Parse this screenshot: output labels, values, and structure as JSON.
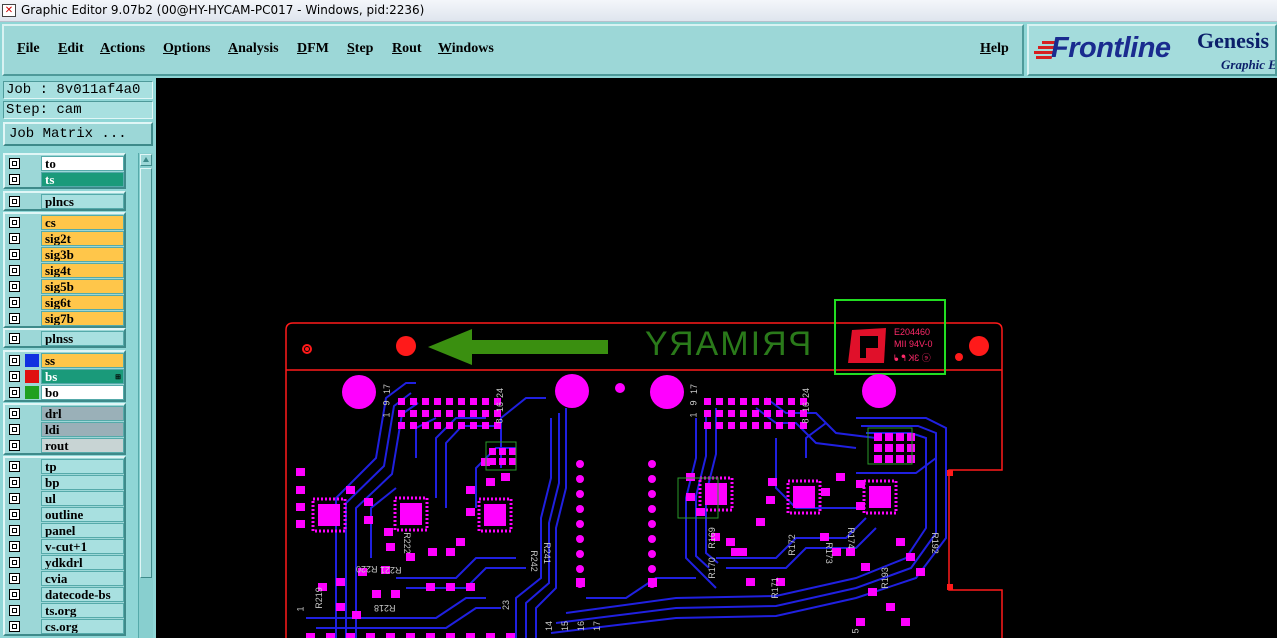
{
  "window": {
    "title": "Graphic Editor 9.07b2 (00@HY-HYCAM-PC017 - Windows, pid:2236)"
  },
  "menu": [
    "File",
    "Edit",
    "Actions",
    "Options",
    "Analysis",
    "DFM",
    "Step",
    "Rout",
    "Windows"
  ],
  "help": "Help",
  "logo": {
    "brand": "Frontline",
    "product": "Genesis",
    "subtitle": "Graphic E"
  },
  "job": {
    "job_label": "Job : 8v011af4a0",
    "step_label": "Step: cam",
    "matrix_button": "Job Matrix ..."
  },
  "layers": [
    {
      "name": "to",
      "color": "#ffffff",
      "selected": false
    },
    {
      "name": "ts",
      "color": "#1a9a7a",
      "selected": true
    },
    {
      "name": "plncs",
      "color": "#a8e0e0",
      "selected": false
    },
    {
      "name": "cs",
      "color": "#ffc64a",
      "selected": false
    },
    {
      "name": "sig2t",
      "color": "#ffc64a",
      "selected": false
    },
    {
      "name": "sig3b",
      "color": "#ffc64a",
      "selected": false
    },
    {
      "name": "sig4t",
      "color": "#ffc64a",
      "selected": false
    },
    {
      "name": "sig5b",
      "color": "#ffc64a",
      "selected": false
    },
    {
      "name": "sig6t",
      "color": "#ffc64a",
      "selected": false
    },
    {
      "name": "sig7b",
      "color": "#ffc64a",
      "selected": false
    },
    {
      "name": "plnss",
      "color": "#a8e0e0",
      "selected": false
    },
    {
      "name": "ss",
      "color": "#ffc64a",
      "selected": false,
      "swatch": "#1030e0"
    },
    {
      "name": "bs",
      "color": "#1a9a7a",
      "selected": true,
      "swatch": "#e01010",
      "mark": "⊞"
    },
    {
      "name": "bo",
      "color": "#ffffff",
      "selected": false,
      "swatch": "#20a020"
    },
    {
      "name": "drl",
      "color": "#9ab0b8",
      "selected": false
    },
    {
      "name": "ldi",
      "color": "#9ab0b8",
      "selected": false
    },
    {
      "name": "rout",
      "color": "#c8d4d4",
      "selected": false
    },
    {
      "name": "tp",
      "color": "#a8e0e0",
      "selected": false
    },
    {
      "name": "bp",
      "color": "#a8e0e0",
      "selected": false
    },
    {
      "name": "ul",
      "color": "#a8e0e0",
      "selected": false
    },
    {
      "name": "outline",
      "color": "#a8e0e0",
      "selected": false
    },
    {
      "name": "panel",
      "color": "#a8e0e0",
      "selected": false
    },
    {
      "name": "v-cut+1",
      "color": "#a8e0e0",
      "selected": false
    },
    {
      "name": "ydkdrl",
      "color": "#a8e0e0",
      "selected": false
    },
    {
      "name": "cvia",
      "color": "#a8e0e0",
      "selected": false
    },
    {
      "name": "datecode-bs",
      "color": "#a8e0e0",
      "selected": false
    },
    {
      "name": "ts.org",
      "color": "#a8e0e0",
      "selected": false
    },
    {
      "name": "cs.org",
      "color": "#a8e0e0",
      "selected": false
    }
  ],
  "canvas": {
    "board_text": "PRIMARY",
    "ul_mark": {
      "line1": "E204460",
      "line2": "MII 94V-0",
      "line3": "ⓔ 3K ᖰ ᖱ"
    },
    "refdes": [
      "1",
      "9",
      "17",
      "8",
      "16",
      "24",
      "1",
      "9",
      "17",
      "8",
      "16",
      "24",
      "R222",
      "R221",
      "R220",
      "R219",
      "R218",
      "R241",
      "R242",
      "23",
      "R170",
      "R169",
      "R171",
      "R172",
      "R173",
      "R174",
      "R193",
      "R192",
      "14",
      "15",
      "16",
      "17",
      "1",
      "5"
    ]
  }
}
